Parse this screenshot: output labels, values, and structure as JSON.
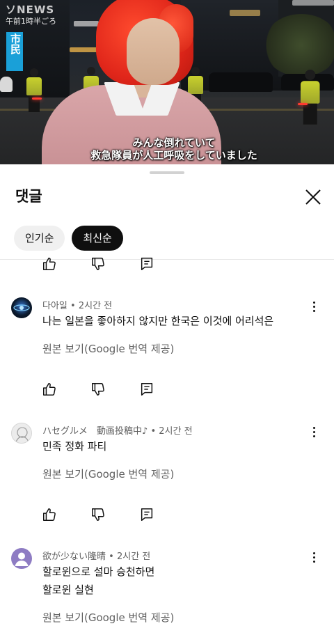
{
  "video": {
    "broadcaster": "NEWS",
    "broadcaster_prefix": "ソ",
    "timestamp": "午前1時半ごろ",
    "speaker_tag": "市民",
    "caption_line1": "みんな倒れていて",
    "caption_line2": "救急隊員が人工呼吸をしていました"
  },
  "sheet": {
    "title": "댓글",
    "close_icon": "close-icon",
    "sort_chips": [
      {
        "label": "인기순",
        "active": false
      },
      {
        "label": "최신순",
        "active": true
      }
    ]
  },
  "comments": [
    {
      "author": "다아일",
      "time": "2시간 전",
      "text_lines": [
        "나는 일본을 좋아하지 않지만 한국은 이것에 어리석은"
      ],
      "translate_label": "원본 보기(Google 번역 제공)"
    },
    {
      "author": "ハセグルメ　動画投稿中♪",
      "time": "2시간 전",
      "text_lines": [
        "민족 정화 파티"
      ],
      "translate_label": "원본 보기(Google 번역 제공)"
    },
    {
      "author": "欲が少ない隆晴",
      "time": "2시간 전",
      "text_lines": [
        "할로윈으로 설마 승천하면",
        "할로윈 실현"
      ],
      "translate_label": "원본 보기(Google 번역 제공)"
    }
  ],
  "meta_separator": "•",
  "icons": {
    "like": "thumbs-up-icon",
    "dislike": "thumbs-down-icon",
    "reply": "reply-icon",
    "more": "more-vert-icon"
  },
  "colors": {
    "chip_active_bg": "#0f0f0f",
    "chip_inactive_bg": "#f0f0f0",
    "secondary_text": "#606060",
    "speaker_tag_bg": "#1aa0d8"
  }
}
